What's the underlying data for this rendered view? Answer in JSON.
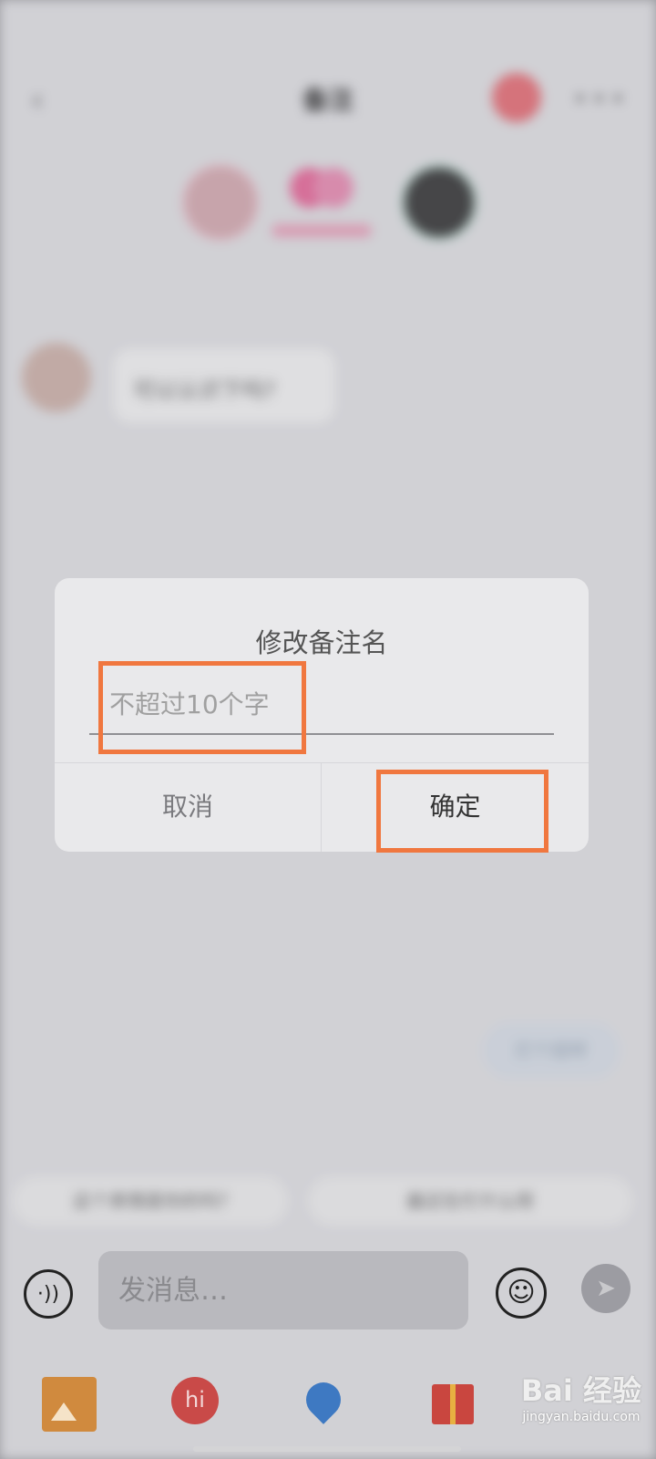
{
  "background": {
    "nav_title": "备注",
    "msg_preview": "可以认识下吗?",
    "pill_text": "打个招呼",
    "suggestion_1": "这个表情是你的吗?",
    "suggestion_2": "最近在忙什么呀"
  },
  "dialog": {
    "title": "修改备注名",
    "input_placeholder": "不超过10个字",
    "input_value": "",
    "cancel_label": "取消",
    "confirm_label": "确定"
  },
  "input_bar": {
    "placeholder": "发消息…"
  },
  "watermark": {
    "logo": "Bai 经验",
    "url": "jingyan.baidu.com"
  },
  "colors": {
    "annotation": "#f0773f",
    "dialog_bg": "#e9e9eb"
  }
}
